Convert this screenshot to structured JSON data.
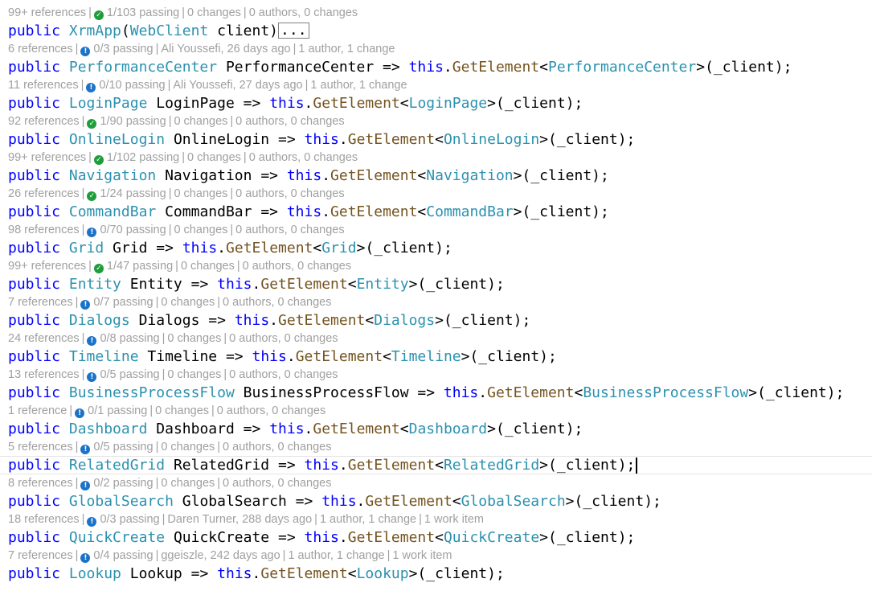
{
  "theme": {
    "keyword_color": "#0000ff",
    "type_color": "#2b91af",
    "method_color": "#74531f",
    "lens_color": "#a0a0a0",
    "pass_icon_color": "#1e9e3a",
    "info_icon_color": "#1a73c9"
  },
  "sep": "|",
  "blocks": [
    {
      "lens": {
        "references": "99+ references",
        "icon": "passed-check-icon",
        "tests": "1/103 passing",
        "author": "0 changes",
        "changes": "0 authors, 0 changes",
        "work_items": ""
      },
      "code": {
        "kind": "ctor",
        "keyword": "public",
        "name": "XrmApp",
        "param_type": "WebClient",
        "param_name": "client",
        "ellipsis": "..."
      }
    },
    {
      "lens": {
        "references": "6 references",
        "icon": "info-icon",
        "tests": "0/3 passing",
        "author": "Ali Youssefi, 26 days ago",
        "changes": "1 author, 1 change",
        "work_items": ""
      },
      "code": {
        "kind": "prop",
        "keyword": "public",
        "type": "PerformanceCenter",
        "name": "PerformanceCenter",
        "arrow": "=>",
        "this": "this",
        "method": "GetElement",
        "generic": "PerformanceCenter",
        "arg": "(_client);"
      }
    },
    {
      "lens": {
        "references": "11 references",
        "icon": "info-icon",
        "tests": "0/10 passing",
        "author": "Ali Youssefi, 27 days ago",
        "changes": "1 author, 1 change",
        "work_items": ""
      },
      "code": {
        "kind": "prop",
        "keyword": "public",
        "type": "LoginPage",
        "name": "LoginPage",
        "arrow": "=>",
        "this": "this",
        "method": "GetElement",
        "generic": "LoginPage",
        "arg": "(_client);"
      }
    },
    {
      "lens": {
        "references": "92 references",
        "icon": "passed-check-icon",
        "tests": "1/90 passing",
        "author": "0 changes",
        "changes": "0 authors, 0 changes",
        "work_items": ""
      },
      "code": {
        "kind": "prop",
        "keyword": "public",
        "type": "OnlineLogin",
        "name": "OnlineLogin",
        "arrow": "=>",
        "this": "this",
        "method": "GetElement",
        "generic": "OnlineLogin",
        "arg": "(_client);"
      }
    },
    {
      "lens": {
        "references": "99+ references",
        "icon": "passed-check-icon",
        "tests": "1/102 passing",
        "author": "0 changes",
        "changes": "0 authors, 0 changes",
        "work_items": ""
      },
      "code": {
        "kind": "prop",
        "keyword": "public",
        "type": "Navigation",
        "name": "Navigation",
        "arrow": "=>",
        "this": "this",
        "method": "GetElement",
        "generic": "Navigation",
        "arg": "(_client);"
      }
    },
    {
      "lens": {
        "references": "26 references",
        "icon": "passed-check-icon",
        "tests": "1/24 passing",
        "author": "0 changes",
        "changes": "0 authors, 0 changes",
        "work_items": ""
      },
      "code": {
        "kind": "prop",
        "keyword": "public",
        "type": "CommandBar",
        "name": "CommandBar",
        "arrow": "=>",
        "this": "this",
        "method": "GetElement",
        "generic": "CommandBar",
        "arg": "(_client);"
      }
    },
    {
      "lens": {
        "references": "98 references",
        "icon": "info-icon",
        "tests": "0/70 passing",
        "author": "0 changes",
        "changes": "0 authors, 0 changes",
        "work_items": ""
      },
      "code": {
        "kind": "prop",
        "keyword": "public",
        "type": "Grid",
        "name": "Grid",
        "arrow": "=>",
        "this": "this",
        "method": "GetElement",
        "generic": "Grid",
        "arg": "(_client);"
      }
    },
    {
      "lens": {
        "references": "99+ references",
        "icon": "passed-check-icon",
        "tests": "1/47 passing",
        "author": "0 changes",
        "changes": "0 authors, 0 changes",
        "work_items": ""
      },
      "code": {
        "kind": "prop",
        "keyword": "public",
        "type": "Entity",
        "name": "Entity",
        "arrow": "=>",
        "this": "this",
        "method": "GetElement",
        "generic": "Entity",
        "arg": "(_client);"
      }
    },
    {
      "lens": {
        "references": "7 references",
        "icon": "info-icon",
        "tests": "0/7 passing",
        "author": "0 changes",
        "changes": "0 authors, 0 changes",
        "work_items": ""
      },
      "code": {
        "kind": "prop",
        "keyword": "public",
        "type": "Dialogs",
        "name": "Dialogs",
        "arrow": "=>",
        "this": "this",
        "method": "GetElement",
        "generic": "Dialogs",
        "arg": "(_client);"
      }
    },
    {
      "lens": {
        "references": "24 references",
        "icon": "info-icon",
        "tests": "0/8 passing",
        "author": "0 changes",
        "changes": "0 authors, 0 changes",
        "work_items": ""
      },
      "code": {
        "kind": "prop",
        "keyword": "public",
        "type": "Timeline",
        "name": "Timeline",
        "arrow": "=>",
        "this": "this",
        "method": "GetElement",
        "generic": "Timeline",
        "arg": "(_client);"
      }
    },
    {
      "lens": {
        "references": "13 references",
        "icon": "info-icon",
        "tests": "0/5 passing",
        "author": "0 changes",
        "changes": "0 authors, 0 changes",
        "work_items": ""
      },
      "code": {
        "kind": "prop",
        "keyword": "public",
        "type": "BusinessProcessFlow",
        "name": "BusinessProcessFlow",
        "arrow": "=>",
        "this": "this",
        "method": "GetElement",
        "generic": "BusinessProcessFlow",
        "arg": "(_client);"
      }
    },
    {
      "lens": {
        "references": "1 reference",
        "icon": "info-icon",
        "tests": "0/1 passing",
        "author": "0 changes",
        "changes": "0 authors, 0 changes",
        "work_items": ""
      },
      "code": {
        "kind": "prop",
        "keyword": "public",
        "type": "Dashboard",
        "name": "Dashboard",
        "arrow": "=>",
        "this": "this",
        "method": "GetElement",
        "generic": "Dashboard",
        "arg": "(_client);"
      }
    },
    {
      "lens": {
        "references": "5 references",
        "icon": "info-icon",
        "tests": "0/5 passing",
        "author": "0 changes",
        "changes": "0 authors, 0 changes",
        "work_items": ""
      },
      "code": {
        "kind": "prop",
        "keyword": "public",
        "type": "RelatedGrid",
        "name": "RelatedGrid",
        "arrow": "=>",
        "this": "this",
        "method": "GetElement",
        "generic": "RelatedGrid",
        "arg": "(_client);",
        "current": true
      }
    },
    {
      "lens": {
        "references": "8 references",
        "icon": "info-icon",
        "tests": "0/2 passing",
        "author": "0 changes",
        "changes": "0 authors, 0 changes",
        "work_items": ""
      },
      "code": {
        "kind": "prop",
        "keyword": "public",
        "type": "GlobalSearch",
        "name": "GlobalSearch",
        "arrow": "=>",
        "this": "this",
        "method": "GetElement",
        "generic": "GlobalSearch",
        "arg": "(_client);"
      }
    },
    {
      "lens": {
        "references": "18 references",
        "icon": "info-icon",
        "tests": "0/3 passing",
        "author": "Daren Turner, 288 days ago",
        "changes": "1 author, 1 change",
        "work_items": "1 work item"
      },
      "code": {
        "kind": "prop",
        "keyword": "public",
        "type": "QuickCreate",
        "name": "QuickCreate",
        "arrow": "=>",
        "this": "this",
        "method": "GetElement",
        "generic": "QuickCreate",
        "arg": "(_client);"
      }
    },
    {
      "lens": {
        "references": "7 references",
        "icon": "info-icon",
        "tests": "0/4 passing",
        "author": "ggeiszle, 242 days ago",
        "changes": "1 author, 1 change",
        "work_items": "1 work item"
      },
      "code": {
        "kind": "prop",
        "keyword": "public",
        "type": "Lookup",
        "name": "Lookup",
        "arrow": "=>",
        "this": "this",
        "method": "GetElement",
        "generic": "Lookup",
        "arg": "(_client);"
      }
    }
  ]
}
